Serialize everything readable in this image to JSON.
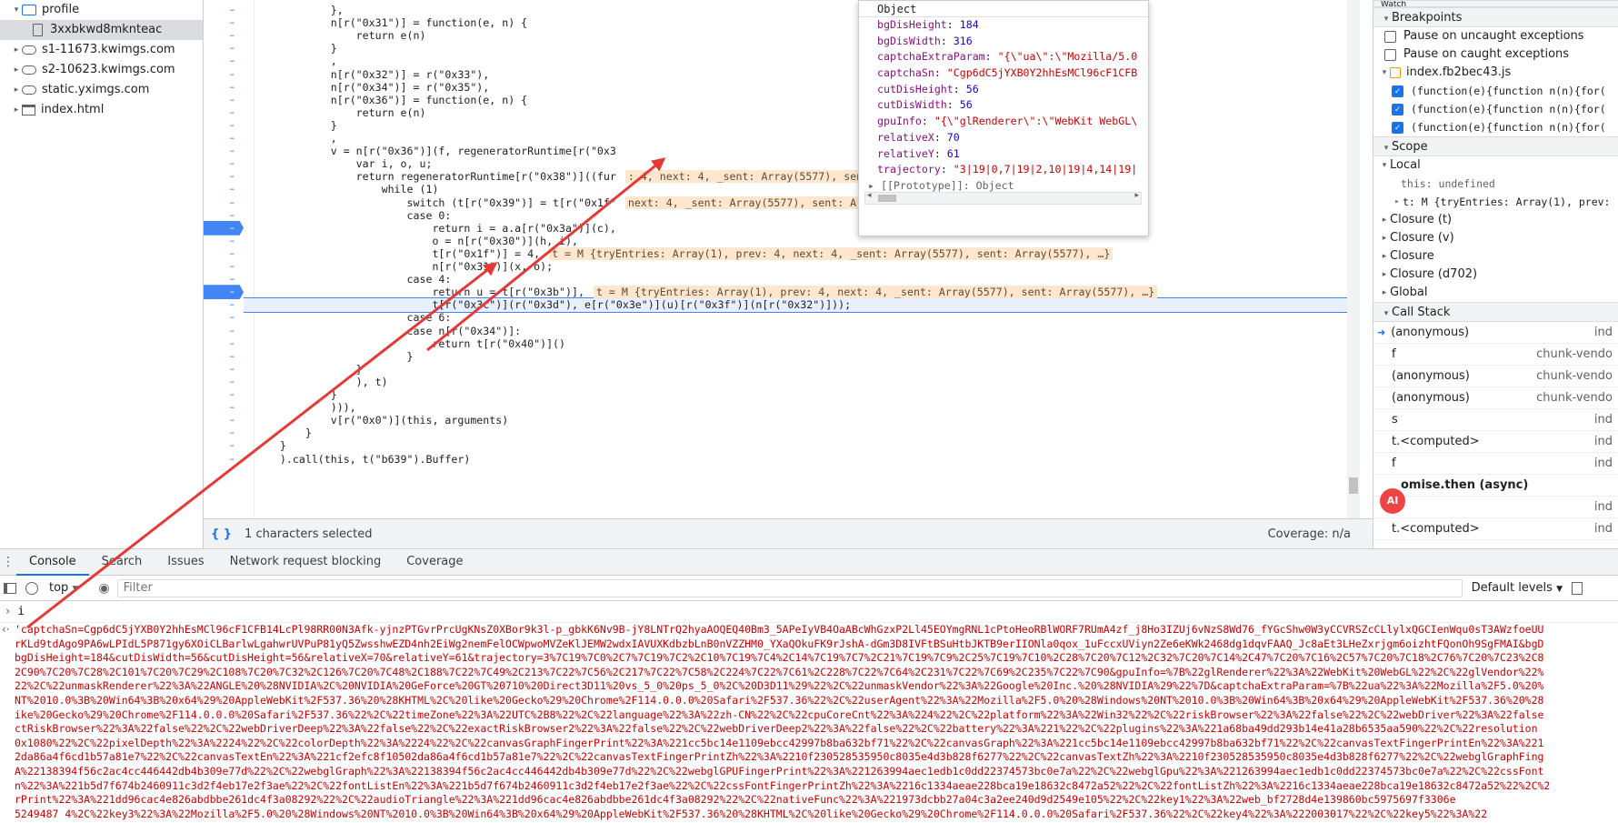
{
  "file_tree": [
    {
      "label": "profile",
      "indent": 1,
      "icon": "folder-icon",
      "expanded": true
    },
    {
      "label": "3xxbkwd8mknteac",
      "indent": 3,
      "icon": "file-icon",
      "selected": true
    },
    {
      "label": "s1-11673.kwimgs.com",
      "indent": 1,
      "icon": "cloud-icon"
    },
    {
      "label": "s2-10623.kwimgs.com",
      "indent": 1,
      "icon": "cloud-icon"
    },
    {
      "label": "static.yximgs.com",
      "indent": 1,
      "icon": "cloud-icon"
    },
    {
      "label": "index.html",
      "indent": 1,
      "icon": "window-icon"
    }
  ],
  "code_lines": [
    {
      "t": "            },"
    },
    {
      "t": "            n[r(\"0x31\")] = function(e, n) {"
    },
    {
      "t": "                return e(n)"
    },
    {
      "t": "            }"
    },
    {
      "t": "            ,"
    },
    {
      "t": "            n[r(\"0x32\")] = r(\"0x33\"),"
    },
    {
      "t": "            n[r(\"0x34\")] = r(\"0x35\"),"
    },
    {
      "t": "            n[r(\"0x36\")] = function(e, n) {"
    },
    {
      "t": "                return e(n)"
    },
    {
      "t": "            }"
    },
    {
      "t": "            ,"
    },
    {
      "t": "            v = n[r(\"0x36\")](f, regeneratorRuntime[r(\"0x3"
    },
    {
      "t": "                var i, o, u;"
    },
    {
      "t": "                return regeneratorRuntime[r(\"0x38\")]((fur"
    },
    {
      "t": "                    while (1)"
    },
    {
      "t": "                        switch (t[r(\"0x39\")] = t[r(\"0x1f\""
    },
    {
      "t": "                        case 0:"
    },
    {
      "t": "                            return i = a.a[r(\"0x3a\")](c),"
    },
    {
      "t": "                            o = n[r(\"0x30\")](h, i),"
    },
    {
      "t": "                            t[r(\"0x1f\")] = 4,"
    },
    {
      "t": "                            n[r(\"0x31\")](x, o);"
    },
    {
      "t": "                        case 4:"
    },
    {
      "t": "                            return u = t[r(\"0x3b\")],"
    },
    {
      "t": "                            t[r(\"0x3c\")](r(\"0x3d\"), e[r(\"0x3e\")](u)[r(\"0x3f\")](n[r(\"0x32\")]));"
    },
    {
      "t": "                        case 6:"
    },
    {
      "t": "                        case n[r(\"0x34\")]:"
    },
    {
      "t": "                            return t[r(\"0x40\")]()"
    },
    {
      "t": "                        }"
    },
    {
      "t": "                }"
    },
    {
      "t": "                ), t)"
    },
    {
      "t": "            }"
    },
    {
      "t": "            ))),"
    },
    {
      "t": "            v[r(\"0x0\")](this, arguments)"
    },
    {
      "t": "        }"
    },
    {
      "t": "    }"
    },
    {
      "t": "    ).call(this, t(\"b639\").Buffer)"
    }
  ],
  "inline_values": {
    "v1": ": 4, next: 4, _sent: Array(5577), sent: Array(5577), …}",
    "v2": "next: 4, _sent: Array(5577), sent: Array(5577), …}",
    "v3": "t = M {tryEntries: Array(1), prev: 4, next: 4, _sent: Array(5577), sent: Array(5577), …}",
    "v4": "t = M {tryEntries: Array(1), prev: 4, next: 4, _sent: Array(5577), sent: Array(5577), …}"
  },
  "popover": {
    "title": "Object",
    "props": [
      {
        "k": "bgDisHeight",
        "v": "184",
        "type": "num"
      },
      {
        "k": "bgDisWidth",
        "v": "316",
        "type": "num"
      },
      {
        "k": "captchaExtraParam",
        "v": "\"{\\\"ua\\\":\\\"Mozilla/5.0",
        "type": "str"
      },
      {
        "k": "captchaSn",
        "v": "\"Cgp6dC5jYXB0Y2hhEsMCl96cF1CFB",
        "type": "str"
      },
      {
        "k": "cutDisHeight",
        "v": "56",
        "type": "num"
      },
      {
        "k": "cutDisWidth",
        "v": "56",
        "type": "num"
      },
      {
        "k": "gpuInfo",
        "v": "\"{\\\"glRenderer\\\":\\\"WebKit WebGL\\",
        "type": "str"
      },
      {
        "k": "relativeX",
        "v": "70",
        "type": "num"
      },
      {
        "k": "relativeY",
        "v": "61",
        "type": "num"
      },
      {
        "k": "trajectory",
        "v": "\"3|19|0,7|19|2,10|19|4,14|19|",
        "type": "str"
      }
    ],
    "proto": "[[Prototype]]: Object"
  },
  "statusbar": {
    "braces": "{ }",
    "selected": "1 characters selected",
    "coverage": "Coverage: n/a"
  },
  "right": {
    "watch": "Watch",
    "breakpoints_header": "Breakpoints",
    "pause_uncaught": "Pause on uncaught exceptions",
    "pause_caught": "Pause on caught exceptions",
    "bp_file": "index.fb2bec43.js",
    "bp_lines": [
      "(function(e){function n(n){for(",
      "(function(e){function n(n){for(",
      "(function(e){function n(n){for("
    ],
    "scope_header": "Scope",
    "local": "Local",
    "this_val": "this: undefined",
    "t_val": "t: M {tryEntries: Array(1), prev:",
    "closures": [
      "Closure (t)",
      "Closure (v)",
      "Closure",
      "Closure (d702)",
      "Global"
    ],
    "callstack_header": "Call Stack",
    "frames": [
      {
        "name": "(anonymous)",
        "loc": "ind",
        "current": true
      },
      {
        "name": "f",
        "loc": "chunk-vendo"
      },
      {
        "name": "(anonymous)",
        "loc": "chunk-vendo"
      },
      {
        "name": "(anonymous)",
        "loc": "chunk-vendo"
      },
      {
        "name": "s",
        "loc": "ind"
      },
      {
        "name": "t.<computed>",
        "loc": "ind"
      },
      {
        "name": "f",
        "loc": "ind"
      }
    ],
    "async": "omise.then (async)",
    "frames2": [
      {
        "name": "s",
        "loc": "ind"
      },
      {
        "name": "t.<computed>",
        "loc": "ind"
      }
    ],
    "ai_badge": "AI"
  },
  "console": {
    "tabs": [
      "Console",
      "Search",
      "Issues",
      "Network request blocking",
      "Coverage"
    ],
    "active_tab": "Console",
    "context": "top",
    "filter_placeholder": "Filter",
    "levels": "Default levels",
    "prompt_input": "i",
    "output_lines": [
      "'captchaSn=Cgp6dC5jYXB0Y2hhEsMCl96cF1CFB14LcPl98RR00N3Afk-yjnzPTGvrPrcUgKNsZ0XBor9k3l-p_gbkK6Nv9B-jY8LNTrQ2hyaAOQEQ40Bm3_5APeIyVB4OaABcWhGzxP2Ll45EOYmgRNL1cPtoHeoRBlWORF7RUmA4zf_j8Ho3IZUj6vNzS8Wd76_fYGcShw0W3yCCVRSZcCLlylxQGCIenWqu0sT3AWzfoeUU",
      "rKLd9tdAgo9PA6wLPIdL5P871gy6XOiCLBarlwLgahwrUVPuP81yQ5ZwsshwEZD4nh2EiWg2nemFelOCWpwoMVZeKlJEMW2wdxIAVUXKdbzbLnB0nVZZHM0_YXaQOkuFK9rJshA-dGm3D8IVFtBSuHtbJKTB9erIIONla0qox_1uFccxUViyn2Ze6eKWk2468dg1dqvFAAQ_Jc8aEt3LHeZxrjgm6oizhtFQonOh9SgFMAI&bgD",
      "bgDisHeight=184&cutDisWidth=56&cutDisHeight=56&relativeX=70&relativeY=61&trajectory=3%7C19%7C0%2C7%7C19%7C2%2C10%7C19%7C4%2C14%7C19%7C7%2C21%7C19%7C9%2C25%7C19%7C10%2C28%7C20%7C12%2C32%7C20%7C14%2C47%7C20%7C16%2C57%7C20%7C18%2C76%7C20%7C23%2C8",
      "2C90%7C20%7C28%2C101%7C20%7C29%2C108%7C20%7C32%2C126%7C20%7C48%2C188%7C22%7C49%2C213%7C22%7C56%2C217%7C22%7C58%2C224%7C22%7C61%2C228%7C22%7C64%2C231%7C22%7C69%2C235%7C22%7C90&gpuInfo=%7B%22glRenderer%22%3A%22WebKit%20WebGL%22%2C%22glVendor%22%",
      "22%2C%22unmaskRenderer%22%3A%22ANGLE%20%28NVIDIA%2C%20NVIDIA%20GeForce%20GT%20710%20Direct3D11%20vs_5_0%20ps_5_0%2C%20D3D11%29%22%2C%22unmaskVendor%22%3A%22Google%20Inc.%20%28NVIDIA%29%22%7D&captchaExtraParam=%7B%22ua%22%3A%22Mozilla%2F5.0%20%",
      "NT%2010.0%3B%20Win64%3B%20x64%29%20AppleWebKit%2F537.36%20%28KHTML%2C%20like%20Gecko%29%20Chrome%2F114.0.0.0%20Safari%2F537.36%22%2C%22userAgent%22%3A%22Mozilla%2F5.0%20%28Windows%20NT%2010.0%3B%20Win64%3B%20x64%29%20AppleWebKit%2F537.36%20%28",
      "ike%20Gecko%29%20Chrome%2F114.0.0.0%20Safari%2F537.36%22%2C%22timeZone%22%3A%22UTC%2B8%22%2C%22language%22%3A%22zh-CN%22%2C%22cpuCoreCnt%22%3A%224%22%2C%22platform%22%3A%22Win32%22%2C%22riskBrowser%22%3A%22false%22%2C%22webDriver%22%3A%22false",
      "ctRiskBrowser%22%3A%22false%22%2C%22webDriverDeep%22%3A%22false%22%2C%22exactRiskBrowser2%22%3A%22false%22%2C%22webDriverDeep2%22%3A%22false%22%2C%22battery%22%3A%221%22%2C%22plugins%22%3A%221a68ba49dd293b14e41a28b6535aa590%22%2C%22resolution",
      "0x1080%22%2C%22pixelDepth%22%3A%2224%22%2C%22colorDepth%22%3A%2224%22%2C%22canvasGraphFingerPrint%22%3A%221cc5bc14e1109ebcc42997b8ba632bf71%22%2C%22canvasGraph%22%3A%221cc5bc14e1109ebcc42997b8ba632bf71%22%2C%22canvasTextFingerPrintEn%22%3A%221",
      "2da86a4f6cd1b57a81e7%22%2C%22canvasTextEn%22%3A%221cf2efc8f10502da86a4f6cd1b57a81e7%22%2C%22canvasTextFingerPrintZh%22%3A%2210f230528535950c8035e4d3b828f6277%22%2C%22canvasTextZh%22%3A%2210f230528535950c8035e4d3b828f6277%22%2C%22webglGraphFing",
      "A%22138394f56c2ac4cc446442db4b309e77d%22%2C%22webglGraph%22%3A%22138394f56c2ac4cc446442db4b309e77d%22%2C%22webglGPUFingerPrint%22%3A%221263994aec1edb1c0dd22374573bc0e7a%22%2C%22webglGpu%22%3A%221263994aec1edb1c0dd22374573bc0e7a%22%2C%22cssFont",
      "n%22%3A%221b5d7f674b2460911c3d2f4eb17e2f3ae%22%2C%22fontListEn%22%3A%221b5d7f674b2460911c3d2f4eb17e2f3ae%22%2C%22cssFontFingerPrintZh%22%3A%2216c1334aeae228bca19e18632c8472a52%22%2C%22fontListZh%22%3A%2216c1334aeae228bca19e18632c8472a52%22%2C%2",
      "rPrint%22%3A%221dd96cac4e826abdbbe261dc4f3a08292%22%2C%22audioTriangle%22%3A%221dd96cac4e826abdbbe261dc4f3a08292%22%2C%22nativeFunc%22%3A%221973dcbb27a04c3a2ee240d9d2549e105%22%2C%22key1%22%3A%22web_bf2728d4e139860bc5975697f3306e",
      "5249487 4%2C%22key3%22%3A%22Mozilla%2F5.0%20%28Windows%20NT%2010.0%3B%20Win64%3B%20x64%29%20AppleWebKit%2F537.36%20%28KHTML%2C%20like%20Gecko%29%20Chrome%2F114.0.0.0%20Safari%2F537.36%22%2C%22key4%22%3A%222003017%22%2C%22key5%22%3A%22"
    ]
  },
  "colors": {
    "accent": "#1a73e8",
    "annotation_arrow": "#e53935",
    "string_red": "#c80000"
  }
}
